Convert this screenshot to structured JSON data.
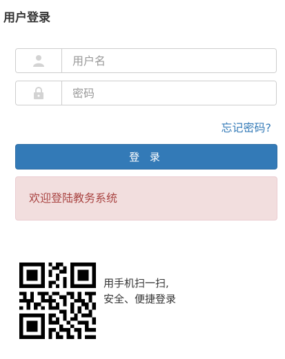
{
  "header": {
    "title": "用户登录"
  },
  "form": {
    "username_placeholder": "用户名",
    "username_icon": "user-icon",
    "password_placeholder": "密码",
    "password_icon": "lock-icon",
    "forgot_link": "忘记密码?",
    "login_button": "登 录"
  },
  "alert": {
    "message": "欢迎登陆教务系统"
  },
  "qr": {
    "line1": "用手机扫一扫,",
    "line2": "安全、便捷登录"
  },
  "colors": {
    "primary": "#337ab7",
    "alert_bg": "#f2dede",
    "alert_text": "#a94442",
    "icon_gray": "#d3d3d3"
  }
}
